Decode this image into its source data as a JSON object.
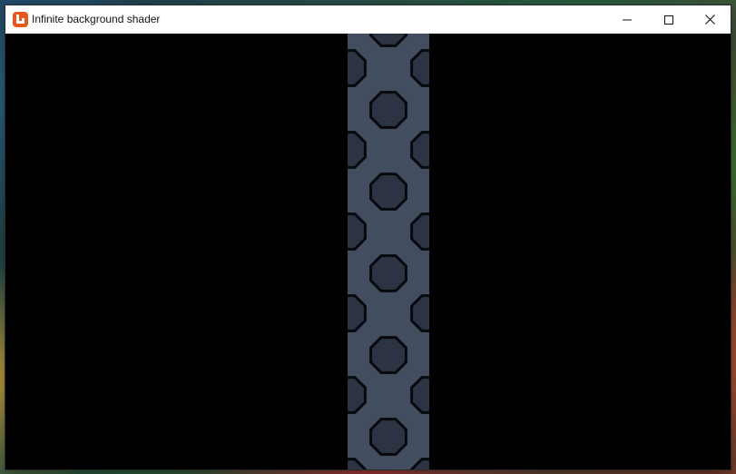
{
  "window": {
    "title": "Infinite background shader",
    "buttons": {
      "minimize": "minimize-icon",
      "maximize": "maximize-icon",
      "close": "close-icon"
    }
  },
  "app_icon": "monogame-logo-icon",
  "colors": {
    "titlebar": "#ffffff",
    "client_background": "#000000",
    "strip_background": "#434d60",
    "octagon_fill": "#2c3444",
    "octagon_stroke": "#07090d",
    "icon_accent": "#e8581c"
  }
}
